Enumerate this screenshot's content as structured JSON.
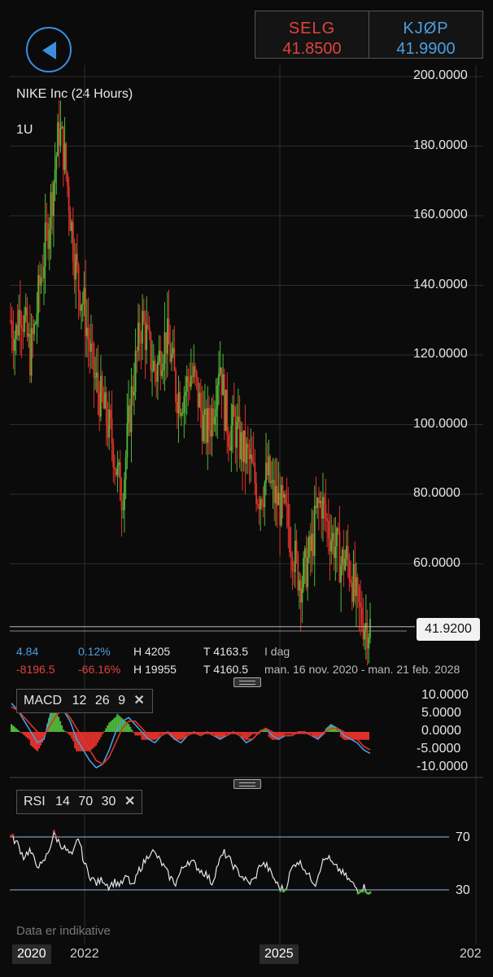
{
  "header": {
    "sell_label": "SELG",
    "sell_value": "41.8500",
    "buy_label": "KJØP",
    "buy_value": "41.9900"
  },
  "chart": {
    "instrument": "NIKE Inc (24 Hours)",
    "period": "1U",
    "y_ticks": [
      "200.0000",
      "180.0000",
      "160.0000",
      "140.0000",
      "120.0000",
      "100.0000",
      "80.0000",
      "60.0000"
    ],
    "current_price": "41.9200",
    "colors": {
      "up": "#4fb83a",
      "down": "#e0322a",
      "accent": "#3a8fe0"
    }
  },
  "stats": {
    "row1": {
      "change": "4.84",
      "change_pct": "0.12%",
      "high": "H 4205",
      "last": "T 4163.5",
      "range_label": "I dag"
    },
    "row2": {
      "change": "-8196.5",
      "change_pct": "-66.16%",
      "high": "H 19955",
      "last": "T 4160.5",
      "range_label": "man. 16 nov. 2020 - man. 21 feb. 2028"
    }
  },
  "macd": {
    "name": "MACD",
    "params": [
      "12",
      "26",
      "9"
    ],
    "y_ticks": [
      "10.0000",
      "5.0000",
      "0.0000",
      "-5.0000",
      "-10.0000"
    ]
  },
  "rsi": {
    "name": "RSI",
    "params": [
      "14",
      "70",
      "30"
    ],
    "y_ticks": [
      "70",
      "30"
    ],
    "footnote": "Data er indikative"
  },
  "x_axis": {
    "labels": [
      "2020",
      "2022",
      "2025",
      "202"
    ]
  },
  "chart_data": {
    "type": "candlestick",
    "title": "NIKE Inc (24 Hours)",
    "timeframe": "1U",
    "x_labels": [
      "2020",
      "2022",
      "2025",
      "202"
    ],
    "y_ticks": [
      200,
      180,
      160,
      140,
      120,
      100,
      80,
      60
    ],
    "current_price": 41.92,
    "approx_weekly_closes": [
      130,
      125,
      135,
      128,
      120,
      128,
      140,
      150,
      160,
      172,
      185,
      178,
      165,
      150,
      140,
      135,
      125,
      115,
      110,
      105,
      100,
      95,
      85,
      80,
      95,
      110,
      120,
      130,
      125,
      118,
      115,
      122,
      125,
      120,
      110,
      108,
      110,
      115,
      112,
      105,
      98,
      100,
      108,
      120,
      105,
      98,
      100,
      95,
      92,
      90,
      85,
      80,
      82,
      86,
      80,
      78,
      75,
      72,
      65,
      58,
      55,
      60,
      65,
      75,
      78,
      72,
      68,
      65,
      60,
      62,
      58,
      50,
      45,
      43,
      42
    ]
  },
  "macd_data": {
    "macd": [
      8,
      6,
      3,
      0,
      -3,
      -2,
      5,
      8,
      6,
      3,
      -2,
      -5,
      -8,
      -10,
      -9,
      -5,
      0,
      3,
      4,
      2,
      0,
      -2,
      -3,
      -1,
      0,
      -2,
      -3,
      -1,
      0,
      -1,
      0,
      -1,
      -2,
      -1,
      0,
      -1,
      -3,
      -2,
      0,
      1,
      -1,
      -2,
      -1,
      -1,
      0,
      0,
      -1,
      -2,
      0,
      2,
      1,
      -1,
      -2,
      -3,
      -5,
      -6
    ],
    "signal": [
      7,
      6,
      4,
      2,
      0,
      -1,
      2,
      5,
      6,
      4,
      1,
      -2,
      -5,
      -8,
      -9,
      -7,
      -3,
      1,
      3,
      3,
      1,
      -1,
      -2,
      -1,
      0,
      -1,
      -2,
      -1,
      0,
      -1,
      0,
      -1,
      -1,
      -1,
      0,
      -1,
      -2,
      -2,
      0,
      1,
      0,
      -1,
      -1,
      -1,
      0,
      0,
      -1,
      -1,
      0,
      1,
      1,
      0,
      -1,
      -2,
      -4,
      -5
    ]
  },
  "rsi_data": {
    "values": [
      70,
      65,
      55,
      60,
      50,
      48,
      58,
      72,
      65,
      60,
      55,
      70,
      50,
      40,
      35,
      38,
      33,
      36,
      34,
      40,
      32,
      45,
      52,
      60,
      55,
      48,
      40,
      35,
      45,
      52,
      50,
      45,
      42,
      35,
      50,
      58,
      52,
      45,
      40,
      35,
      38,
      50,
      48,
      40,
      32,
      30,
      45,
      52,
      48,
      40,
      35,
      50,
      55,
      48,
      45,
      40,
      35,
      30,
      32,
      28
    ]
  }
}
